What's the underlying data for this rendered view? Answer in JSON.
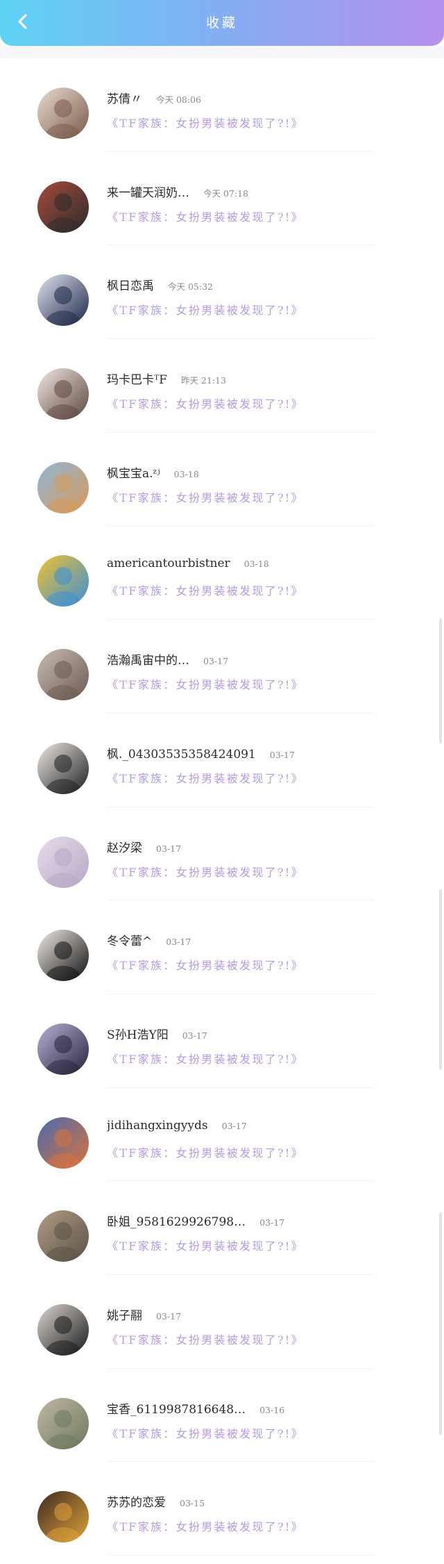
{
  "header": {
    "title": "收藏",
    "back_icon": "chevron-left-icon"
  },
  "favorites": [
    {
      "name": "苏倩〃",
      "time": "今天 08:06",
      "song": "《TF家族：女扮男装被发现了?!》",
      "colors": [
        "#7a5a4a",
        "#e8dcd0"
      ]
    },
    {
      "name": "来一罐天润奶…",
      "time": "今天 07:18",
      "song": "《TF家族：女扮男装被发现了?!》",
      "colors": [
        "#2c2c2c",
        "#a84a3a"
      ]
    },
    {
      "name": "枫日恋禹",
      "time": "今天 05:32",
      "song": "《TF家族：女扮男装被发现了?!》",
      "colors": [
        "#1d2747",
        "#dfe3f0"
      ]
    },
    {
      "name": "玛卡巴卡ᵀF",
      "time": "昨天 21:13",
      "song": "《TF家族：女扮男装被发现了?!》",
      "colors": [
        "#5e4640",
        "#f0e6e0"
      ]
    },
    {
      "name": "枫宝宝a.ᶻʲ",
      "time": "03-18",
      "song": "《TF家族：女扮男装被发现了?!》",
      "colors": [
        "#d89a5a",
        "#8fb6d6"
      ]
    },
    {
      "name": "americantourbistner",
      "time": "03-18",
      "song": "《TF家族：女扮男装被发现了?!》",
      "colors": [
        "#3a8fd8",
        "#f2c12e"
      ]
    },
    {
      "name": "浩瀚禹宙中的…",
      "time": "03-17",
      "song": "《TF家族：女扮男装被发现了?!》",
      "colors": [
        "#6b5a52",
        "#c8bcb2"
      ]
    },
    {
      "name": "枫._04303535358424091",
      "time": "03-17",
      "song": "《TF家族：女扮男装被发现了?!》",
      "colors": [
        "#1e1e22",
        "#efe9e4"
      ]
    },
    {
      "name": "赵汐梁",
      "time": "03-17",
      "song": "《TF家族：女扮男装被发现了?!》",
      "colors": [
        "#b8a8c6",
        "#e6dcea"
      ]
    },
    {
      "name": "冬令蕾^",
      "time": "03-17",
      "song": "《TF家族：女扮男装被发现了?!》",
      "colors": [
        "#0e0e0e",
        "#f4eee8"
      ]
    },
    {
      "name": "S孙H浩Y阳",
      "time": "03-17",
      "song": "《TF家族：女扮男装被发现了?!》",
      "colors": [
        "#27233a",
        "#b9b1d8"
      ]
    },
    {
      "name": "jidihangxingyyds",
      "time": "03-17",
      "song": "《TF家族：女扮男装被发现了?!》",
      "colors": [
        "#d9733a",
        "#4a6ab2"
      ]
    },
    {
      "name": "卧姐_9581629926798…",
      "time": "03-17",
      "song": "《TF家族：女扮男装被发现了?!》",
      "colors": [
        "#5a5246",
        "#b39c84"
      ]
    },
    {
      "name": "姚子翮",
      "time": "03-17",
      "song": "《TF家族：女扮男装被发现了?!》",
      "colors": [
        "#1a1a1a",
        "#dcd6d0"
      ]
    },
    {
      "name": "宝香_6119987816648…",
      "time": "03-16",
      "song": "《TF家族：女扮男装被发现了?!》",
      "colors": [
        "#6c7a5c",
        "#c2b6a4"
      ]
    },
    {
      "name": "苏苏的恋爱",
      "time": "03-15",
      "song": "《TF家族：女扮男装被发现了?!》",
      "colors": [
        "#e0a23a",
        "#3d2a22"
      ]
    }
  ]
}
